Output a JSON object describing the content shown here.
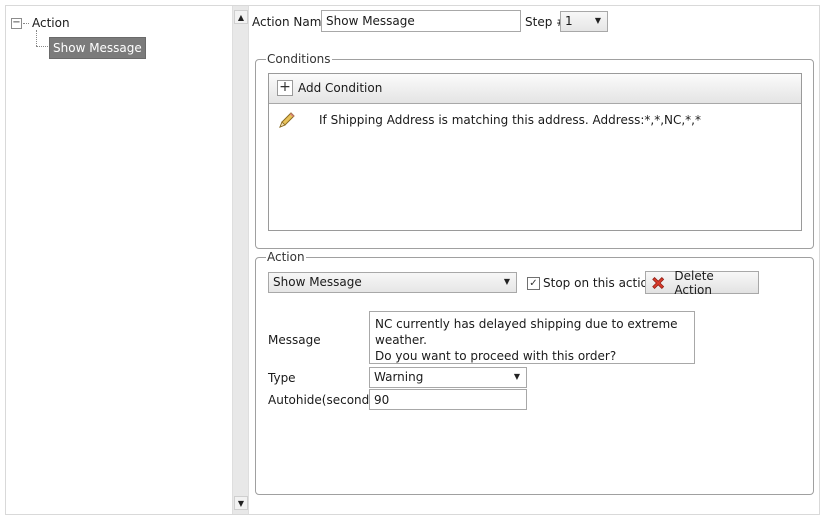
{
  "tree": {
    "root_label": "Action",
    "expander_glyph": "−",
    "child_label": "Show Message"
  },
  "scrollbar": {
    "up_glyph": "▲",
    "down_glyph": "▼"
  },
  "header": {
    "action_name_label": "Action Name",
    "action_name_value": "Show Message",
    "step_label": "Step #",
    "step_value": "1"
  },
  "conditions": {
    "title": "Conditions",
    "add_button_label": "Add Condition",
    "add_icon_glyph": "+",
    "rows": [
      {
        "text": "If Shipping Address is matching this address. Address:*,*,NC,*,*"
      }
    ]
  },
  "action": {
    "title": "Action",
    "type_value": "Show Message",
    "stop_checkbox_checked_glyph": "✓",
    "stop_label": "Stop on this action",
    "delete_label": "Delete Action",
    "message_label": "Message",
    "message_lines": [
      "NC currently has delayed shipping due to extreme weather.",
      "Do you want to proceed with this order?"
    ],
    "type_label": "Type",
    "type_select_value": "Warning",
    "autohide_label": "Autohide(seconds)",
    "autohide_value": "90"
  },
  "colors": {
    "selection_bg": "#7b7b7b",
    "delete_icon": "#d83b2b",
    "pencil_icon": "#e0b84a"
  },
  "icons": [
    "expander-minus-icon",
    "scroll-up-icon",
    "scroll-down-icon",
    "plus-icon",
    "pencil-icon",
    "checkbox-icon",
    "delete-x-icon",
    "chevron-down-icon"
  ]
}
